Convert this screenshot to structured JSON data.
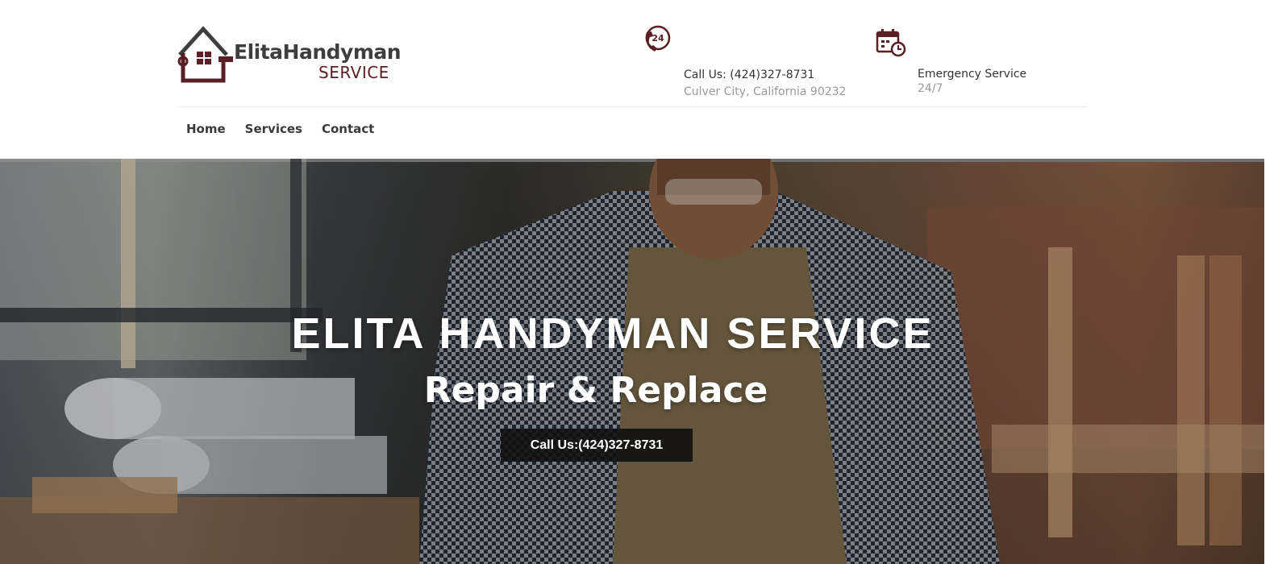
{
  "brand": {
    "name": "ElitaHandyman",
    "sub": "SERVICE",
    "primary_color": "#5a1f22",
    "text_color": "#3e3e3e"
  },
  "header_info": {
    "phone": {
      "icon": "phone-24-icon",
      "title": "Call Us: (424)327-8731",
      "subtitle": "Culver City, California 90232",
      "icon_badge": "24"
    },
    "hours": {
      "icon": "calendar-clock-icon",
      "title": "Emergency Service",
      "subtitle": "24/7"
    }
  },
  "nav": {
    "items": [
      {
        "label": "Home"
      },
      {
        "label": "Services"
      },
      {
        "label": "Contact"
      }
    ]
  },
  "hero": {
    "title": "ELITA HANDYMAN SERVICE",
    "subtitle": "Repair & Replace",
    "cta_label": "Call Us:(424)327-8731",
    "cta_color": "#0f0f0f"
  }
}
